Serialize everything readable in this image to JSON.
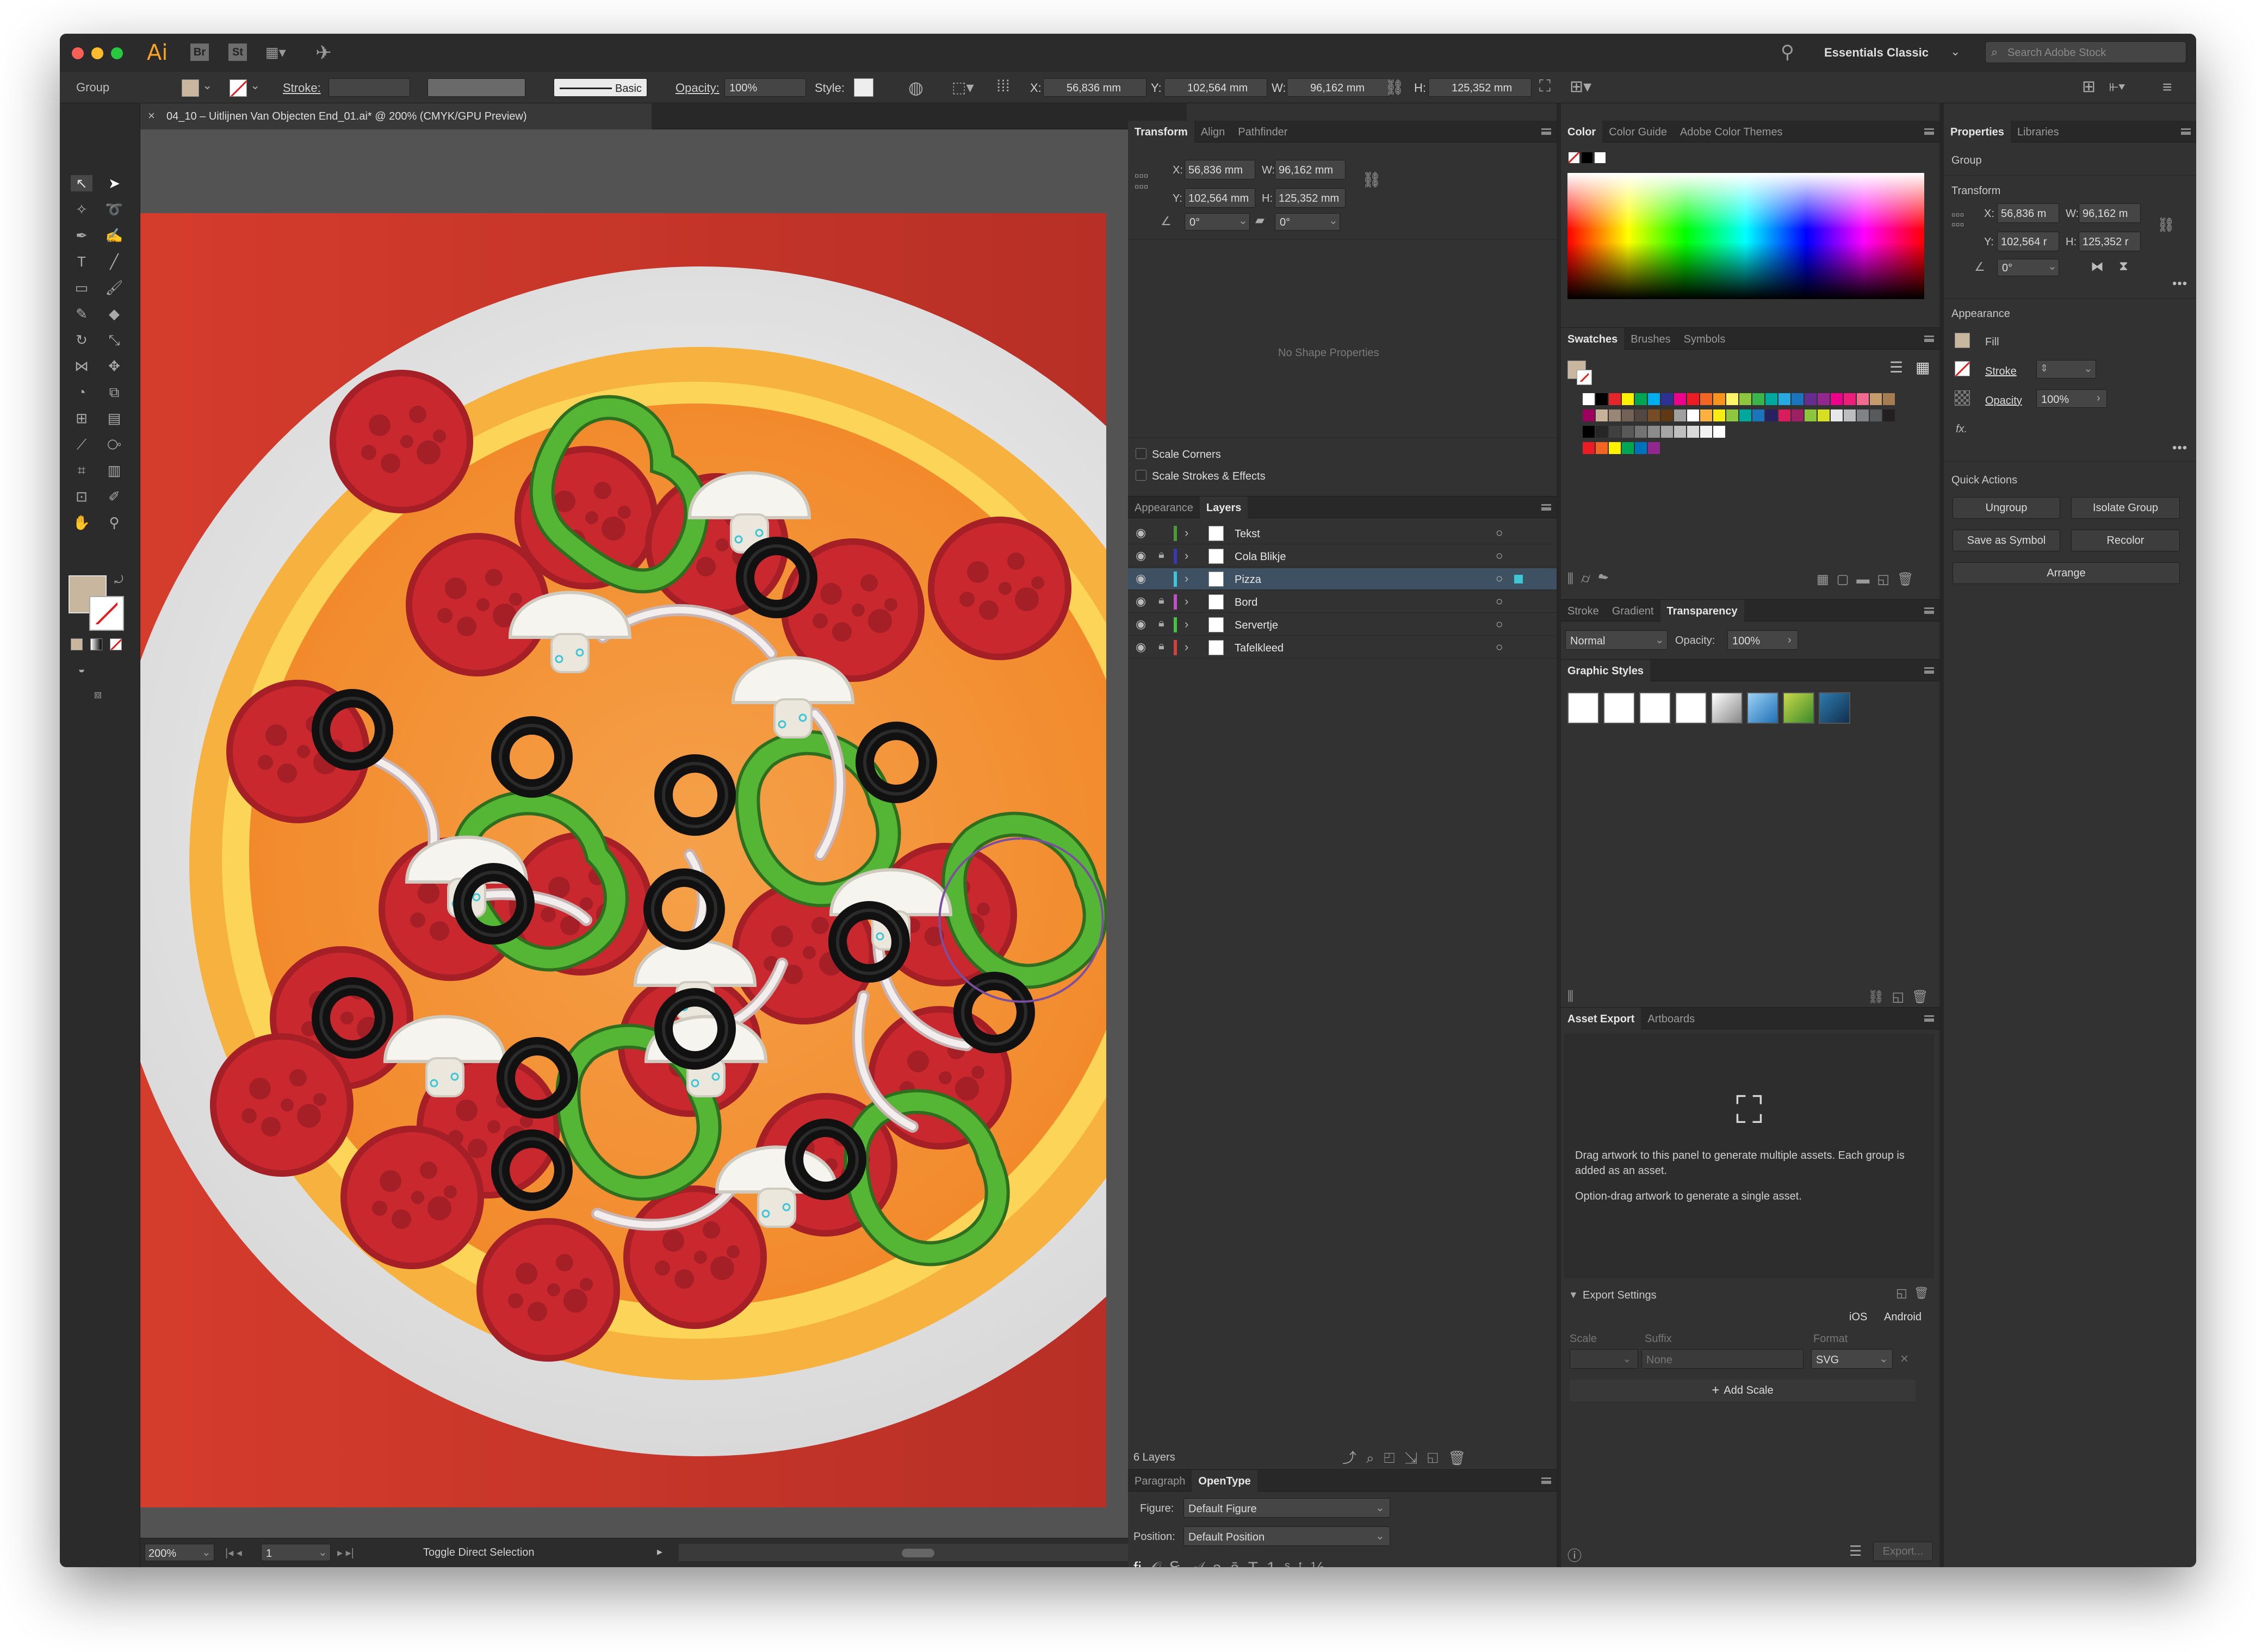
{
  "app": {
    "logo": "Ai",
    "br": "Br",
    "st": "St",
    "workspace": "Essentials Classic",
    "search_placeholder": "Search Adobe Stock"
  },
  "control": {
    "selection": "Group",
    "stroke_label": "Stroke:",
    "brush": "Basic",
    "opacity_label": "Opacity:",
    "opacity_value": "100%",
    "style_label": "Style:",
    "x_label": "X:",
    "x_value": "56,836 mm",
    "y_label": "Y:",
    "y_value": "102,564 mm",
    "w_label": "W:",
    "w_value": "96,162 mm",
    "h_label": "H:",
    "h_value": "125,352 mm"
  },
  "document": {
    "tab_title": "04_10 – Uitlijnen Van Objecten End_01.ai* @ 200% (CMYK/GPU Preview)",
    "zoom": "200%",
    "artboard": "1",
    "status": "Toggle Direct Selection"
  },
  "transform_panel": {
    "tabs": [
      "Transform",
      "Align",
      "Pathfinder"
    ],
    "x_label": "X:",
    "x": "56,836 mm",
    "y_label": "Y:",
    "y": "102,564 mm",
    "w_label": "W:",
    "w": "96,162 mm",
    "h_label": "H:",
    "h": "125,352 mm",
    "angle": "0°",
    "shear": "0°",
    "empty": "No Shape Properties",
    "scale_corners": "Scale Corners",
    "scale_strokes": "Scale Strokes & Effects"
  },
  "layers_panel": {
    "tabs": [
      "Appearance",
      "Layers"
    ],
    "count": "6 Layers",
    "layers": [
      {
        "name": "Tekst",
        "color": "#4a9a3a",
        "locked": false,
        "selected": false
      },
      {
        "name": "Cola Blikje",
        "color": "#3a3ab0",
        "locked": true,
        "selected": false
      },
      {
        "name": "Pizza",
        "color": "#3fc6d6",
        "locked": false,
        "selected": true
      },
      {
        "name": "Bord",
        "color": "#c050c8",
        "locked": true,
        "selected": false
      },
      {
        "name": "Servertje",
        "color": "#46c046",
        "locked": true,
        "selected": false
      },
      {
        "name": "Tafelkleed",
        "color": "#d24040",
        "locked": true,
        "selected": false
      }
    ]
  },
  "type_panel": {
    "tabs": [
      "Paragraph",
      "OpenType"
    ],
    "figure_label": "Figure:",
    "figure_value": "Default Figure",
    "position_label": "Position:",
    "position_value": "Default Position"
  },
  "color_panel": {
    "tabs": [
      "Color",
      "Color Guide",
      "Adobe Color Themes"
    ]
  },
  "swatches_panel": {
    "tabs": [
      "Swatches",
      "Brushes",
      "Symbols"
    ]
  },
  "transparency_panel": {
    "tabs": [
      "Stroke",
      "Gradient",
      "Transparency"
    ],
    "mode": "Normal",
    "opacity_label": "Opacity:",
    "opacity": "100%"
  },
  "styles_panel": {
    "title": "Graphic Styles"
  },
  "asset_panel": {
    "tabs": [
      "Asset Export",
      "Artboards"
    ],
    "hint1": "Drag artwork to this panel to generate multiple assets. Each group is added as an asset.",
    "hint2": "Option-drag artwork to generate a single asset.",
    "export_settings": "Export Settings",
    "ios": "iOS",
    "android": "Android",
    "scale_col": "Scale",
    "suffix_col": "Suffix",
    "format_col": "Format",
    "suffix_placeholder": "None",
    "format": "SVG",
    "add_scale": "Add Scale",
    "export_btn": "Export..."
  },
  "properties_panel": {
    "tabs": [
      "Properties",
      "Libraries"
    ],
    "kind": "Group",
    "transform": "Transform",
    "x_label": "X:",
    "x": "56,836 m",
    "w_label": "W:",
    "w": "96,162 m",
    "y_label": "Y:",
    "y": "102,564 r",
    "h_label": "H:",
    "h": "125,352 r",
    "angle": "0°",
    "appearance": "Appearance",
    "fill": "Fill",
    "stroke": "Stroke",
    "opacity_label": "Opacity",
    "opacity": "100%",
    "fx": "fx.",
    "quick_actions": "Quick Actions",
    "ungroup": "Ungroup",
    "isolate": "Isolate Group",
    "save_symbol": "Save as Symbol",
    "recolor": "Recolor",
    "arrange": "Arrange"
  },
  "colors": {
    "fill": "#c8b79e",
    "canvas_bg": "#c9362a",
    "plate": "#e9e9e9",
    "crust": "#f5b440",
    "sauce": "#f08a2e",
    "pepperoni": "#c9282e",
    "pepper": "#55b535",
    "olive": "#111111",
    "mushroom": "#f6f4ef"
  }
}
